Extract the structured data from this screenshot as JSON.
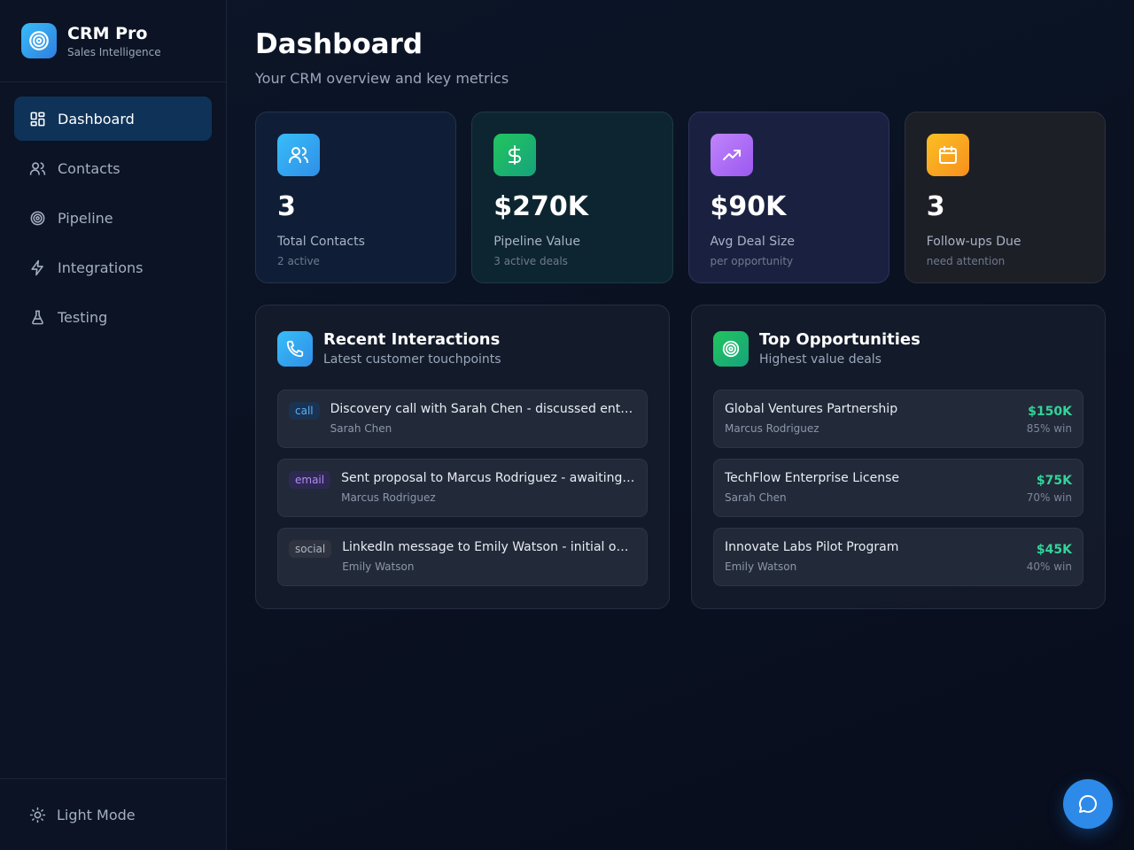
{
  "brand": {
    "title": "CRM Pro",
    "subtitle": "Sales Intelligence"
  },
  "nav": {
    "items": [
      {
        "label": "Dashboard",
        "icon": "dashboard-icon",
        "active": true
      },
      {
        "label": "Contacts",
        "icon": "users-icon"
      },
      {
        "label": "Pipeline",
        "icon": "target-icon"
      },
      {
        "label": "Integrations",
        "icon": "bolt-icon"
      },
      {
        "label": "Testing",
        "icon": "flask-icon"
      }
    ],
    "theme_toggle": "Light Mode"
  },
  "header": {
    "title": "Dashboard",
    "subtitle": "Your CRM overview and key metrics"
  },
  "stats": [
    {
      "value": "3",
      "label": "Total Contacts",
      "note": "2 active",
      "color": "#38bdf8",
      "icon": "users-icon"
    },
    {
      "value": "$270K",
      "label": "Pipeline Value",
      "note": "3 active deals",
      "color": "#22c55e",
      "icon": "dollar-icon"
    },
    {
      "value": "$90K",
      "label": "Avg Deal Size",
      "note": "per opportunity",
      "color": "#a855f7",
      "icon": "trend-up-icon"
    },
    {
      "value": "3",
      "label": "Follow-ups Due",
      "note": "need attention",
      "color": "#f59e0b",
      "icon": "calendar-icon"
    }
  ],
  "interactions": {
    "title": "Recent Interactions",
    "subtitle": "Latest customer touchpoints",
    "items": [
      {
        "type": "call",
        "text": "Discovery call with Sarah Chen - discussed enterprise needs",
        "person": "Sarah Chen"
      },
      {
        "type": "email",
        "text": "Sent proposal to Marcus Rodriguez - awaiting response",
        "person": "Marcus Rodriguez"
      },
      {
        "type": "social",
        "text": "LinkedIn message to Emily Watson - initial outreach",
        "person": "Emily Watson"
      }
    ]
  },
  "opportunities": {
    "title": "Top Opportunities",
    "subtitle": "Highest value deals",
    "items": [
      {
        "name": "Global Ventures Partnership",
        "contact": "Marcus Rodriguez",
        "amount": "$150K",
        "win": "85% win"
      },
      {
        "name": "TechFlow Enterprise License",
        "contact": "Sarah Chen",
        "amount": "$75K",
        "win": "70% win"
      },
      {
        "name": "Innovate Labs Pilot Program",
        "contact": "Emily Watson",
        "amount": "$45K",
        "win": "40% win"
      }
    ]
  },
  "colors": {
    "accent": "#2d8ae8",
    "success": "#34d399",
    "active_nav": "#0f3358"
  }
}
